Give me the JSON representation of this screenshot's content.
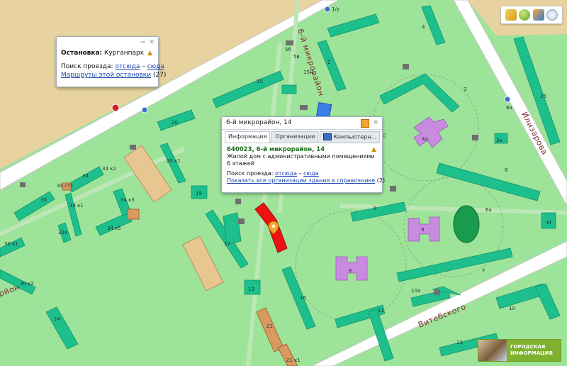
{
  "toolbar": {
    "icons": [
      "ruler-icon",
      "globe-icon",
      "layers-icon",
      "compass-icon"
    ]
  },
  "streets": {
    "microdistrict_north": "6-й микрорайон",
    "microdistrict_west": "рйон",
    "ilizarova": "Илизарова",
    "vitebskogo": "Витебского"
  },
  "building_labels": {
    "b1": "1/у",
    "b2": "2",
    "b3": "3",
    "b4": "4",
    "b4a": "4а",
    "b5": "5",
    "b6": "6",
    "b6a": "6а",
    "b6g": "6г",
    "b7": "7",
    "b8": "8",
    "b8a": "8а",
    "b9": "9",
    "b10": "10",
    "b10a": "10а",
    "b11": "11",
    "b13": "13",
    "b15": "15",
    "b15_1": "15/1",
    "b16": "16",
    "b17": "17",
    "b19": "19",
    "b20": "20",
    "b20k1": "20 к1",
    "b21": "21",
    "b21k1": "21 к1",
    "b23": "23",
    "b24": "24",
    "b26": "26",
    "b30": "30",
    "b30k1": "30 к1",
    "b30k2": "30 к2",
    "b32a": "32а",
    "b34": "34",
    "b34k1": "34 к1",
    "b34k2": "34 к2",
    "b34k3": "34 к3",
    "b34k5": "34 к5",
    "b34str1": "34 ст1",
    "b3a": "3а",
    "b5b": "5б",
    "b5v": "5в"
  },
  "stop_popup": {
    "label": "Остановка:",
    "name": "Курганпарк",
    "search_label": "Поиск проезда:",
    "from_here": "отсюда",
    "dash": "–",
    "to_here": "сюда",
    "routes_link": "Маршруты этой остановки",
    "routes_count": "(27)",
    "pin_glyph": "⊸",
    "close_glyph": "✕"
  },
  "building_popup": {
    "title": "6-й микрорайон, 14",
    "tabs": [
      "Информация",
      "Организации",
      "Компьютерн..."
    ],
    "address": "640023, 6-й микрорайон, 14",
    "description": "Жилой дом с административными помещениями",
    "floors": "6 этажей",
    "search_label": "Поиск проезда:",
    "from_here": "отсюда",
    "dash": "–",
    "to_here": "сюда",
    "orgs_link": "Показать все организации здания в справочнике",
    "orgs_count": "(2)",
    "close_glyph": "✕",
    "scroll_glyph": "⇕"
  },
  "promo": {
    "line1": "ГОРОДСКАЯ",
    "line2": "ИНФОРМАЦИЯ"
  },
  "colors": {
    "ground": "#9ee39a",
    "road": "#ffffff",
    "residential": "#1dc08c",
    "school": "#c98be0",
    "selected": "#ee1111",
    "sand": "#e8d3a0"
  }
}
